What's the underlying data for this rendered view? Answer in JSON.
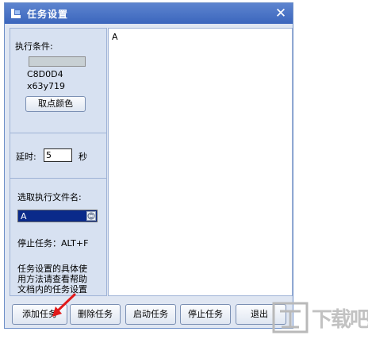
{
  "window": {
    "title": "任务设置",
    "close_symbol": "✕"
  },
  "condition": {
    "label": "执行条件:",
    "color_value": "C8D0D4",
    "coordinates": "x63y719",
    "swatch_color": "#c8d0d4",
    "pick_button": "取点颜色"
  },
  "delay": {
    "label": "延时:",
    "value": "5",
    "unit": "秒"
  },
  "file": {
    "label": "选取执行文件名:",
    "selected": "A"
  },
  "stop_hotkey": "停止任务：ALT+F",
  "help_text": [
    "任务设置的具体使",
    "用方法请查看帮助",
    "文档内的任务设置"
  ],
  "editor": {
    "content": "A"
  },
  "buttons": {
    "add": "添加任务",
    "delete": "删除任务",
    "start": "启动任务",
    "stop": "停止任务",
    "exit": "退出"
  },
  "watermark": "下载吧"
}
